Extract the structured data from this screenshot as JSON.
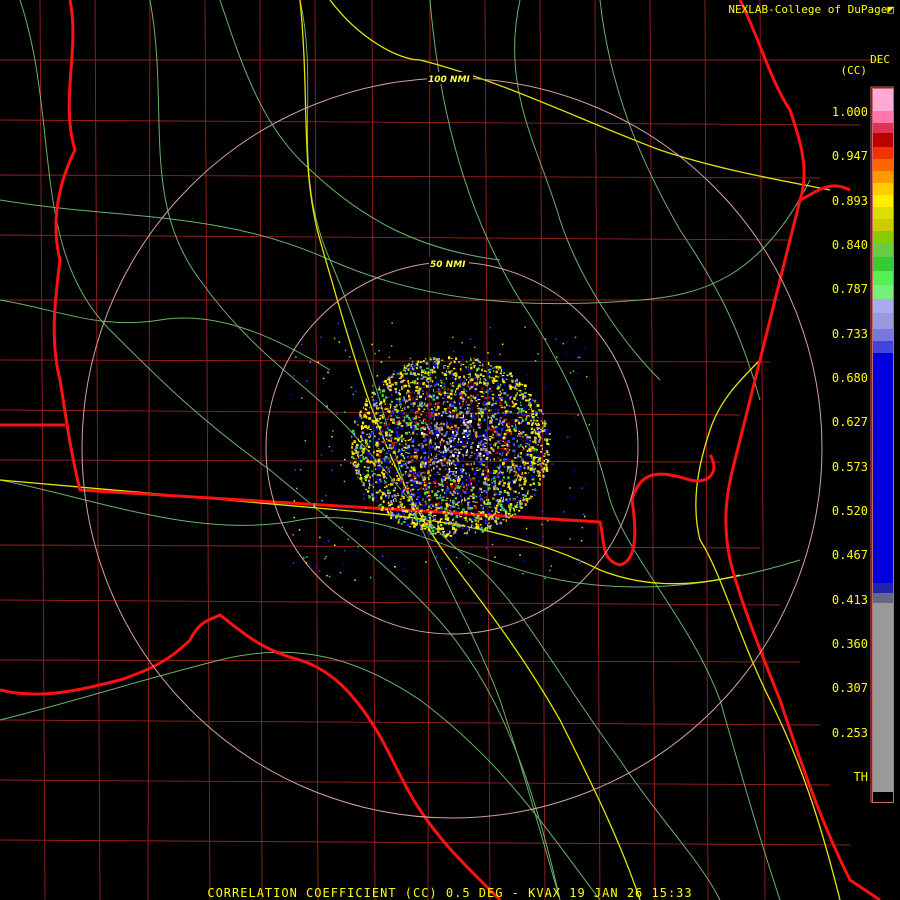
{
  "credit": "NEXLAB-College of DuPage",
  "units_line1": "DEC",
  "units_line2": "(CC)",
  "product_title": "CORRELATION COEFFICIENT (CC) 0.5 DEG - KVAX 19 JAN 26 15:33",
  "range_rings": [
    {
      "label": "50 NMI"
    },
    {
      "label": "100 NMI"
    }
  ],
  "legend": {
    "ticks": [
      "1.000",
      "0.947",
      "0.893",
      "0.840",
      "0.787",
      "0.733",
      "0.680",
      "0.627",
      "0.573",
      "0.520",
      "0.467",
      "0.413",
      "0.360",
      "0.307",
      "0.253",
      "TH"
    ],
    "colors": {
      "pink": "#ff99cc",
      "red": "#cc0000",
      "orange": "#ff8800",
      "yellow": "#ffee00",
      "green": "#44dd44",
      "lavender": "#9999dd",
      "blue": "#0000dd",
      "gray": "#999999"
    }
  },
  "map_colors": {
    "state_border": "#ff1111",
    "county_border": "#aa2222",
    "road": "#e6e600",
    "river": "#88dd88",
    "range_ring": "#d4a0a0"
  }
}
